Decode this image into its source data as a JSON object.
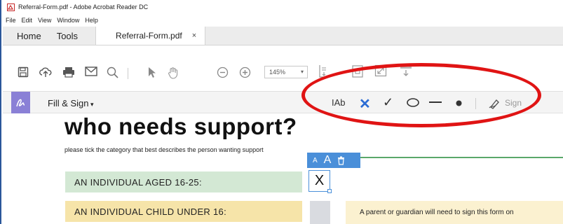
{
  "window": {
    "title": "Referral-Form.pdf - Adobe Acrobat Reader DC"
  },
  "menu": {
    "items": [
      "File",
      "Edit",
      "View",
      "Window",
      "Help"
    ]
  },
  "tabs": {
    "home": "Home",
    "tools": "Tools",
    "file": "Referral-Form.pdf",
    "close": "×"
  },
  "toolbar": {
    "zoom_value": "145%"
  },
  "fill_sign": {
    "label": "Fill & Sign",
    "text_tool": "IAb",
    "sign_label": "Sign"
  },
  "document": {
    "heading": "who needs support?",
    "instruction": "please tick the category that best describes the person wanting support",
    "rows": [
      {
        "label": "AN INDIVIDUAL AGED 16-25:",
        "mark": "X"
      },
      {
        "label": "AN INDIVIDUAL CHILD UNDER 16:",
        "note": "A parent or guardian will need to sign this form on"
      }
    ],
    "mini_toolbar": {
      "small_a": "A",
      "big_a": "A"
    }
  },
  "colors": {
    "accent": "#4a8fd9",
    "fill_sign_badge": "#8a80d6",
    "annotation_oval": "#e01414",
    "row1_bg": "#d3e8d4",
    "row2_bg": "#f6e4a9",
    "divider": "#5aa86a"
  }
}
